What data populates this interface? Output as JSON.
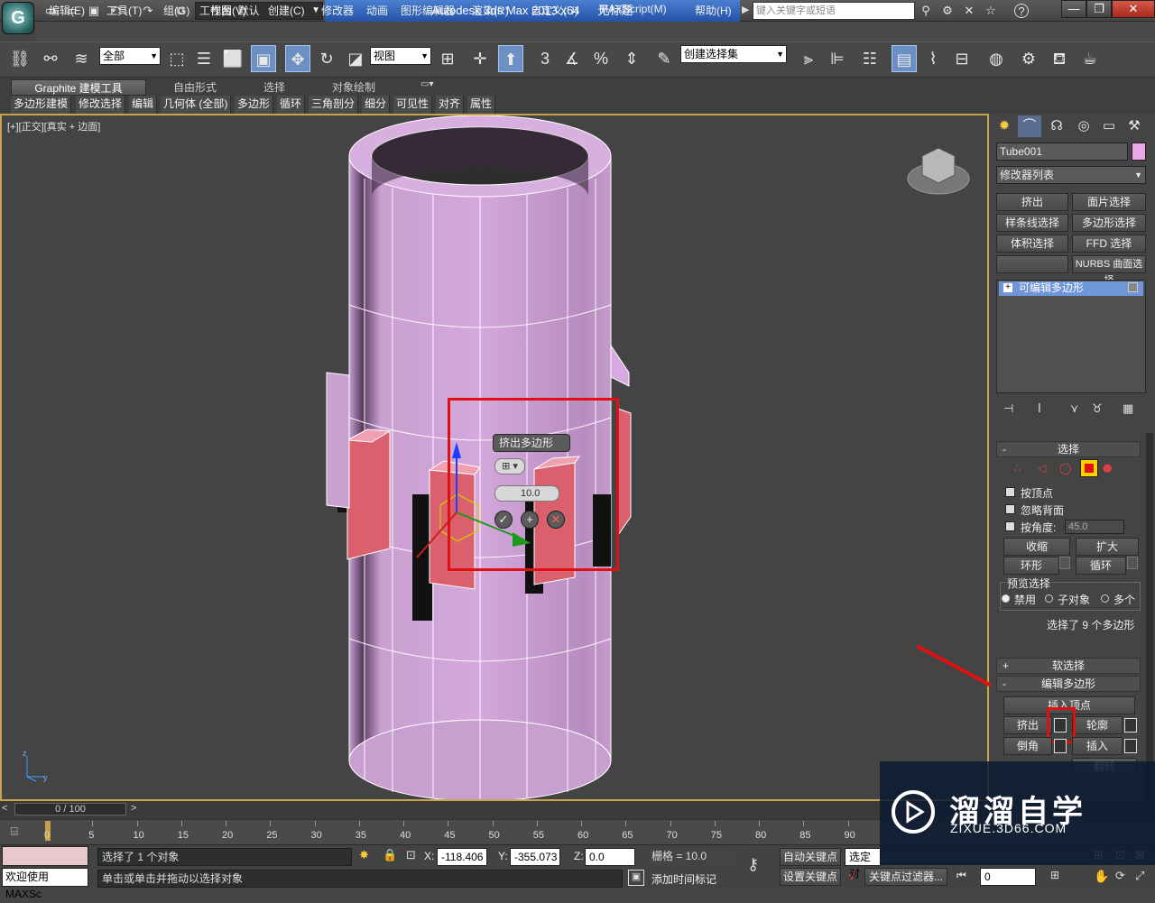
{
  "titlebar": {
    "app_title": "Autodesk 3ds Max  2013 x64",
    "doc_title": "无标题",
    "workspace_label": "工作台: 默认",
    "search_placeholder": "键入关键字或短语",
    "help_icon": "?"
  },
  "menu": [
    "编辑(E)",
    "工具(T)",
    "组(G)",
    "视图(V)",
    "创建(C)",
    "修改器",
    "动画",
    "图形编辑器",
    "渲染(R)",
    "自定义(U)",
    "MAXScript(M)",
    "帮助(H)"
  ],
  "toolbar": {
    "filter_value": "全部",
    "refcoord_value": "视图",
    "selset_value": "创建选择集",
    "snap_label": "3",
    "percent_label": "%"
  },
  "ribbon": {
    "tabs": [
      "Graphite 建模工具",
      "自由形式",
      "选择",
      "对象绘制"
    ],
    "subtabs": [
      "多边形建模",
      "修改选择",
      "编辑",
      "几何体 (全部)",
      "多边形",
      "循环",
      "三角剖分",
      "细分",
      "可见性",
      "对齐",
      "属性"
    ]
  },
  "viewport": {
    "label": "[+][正交][真实 + 边面]"
  },
  "caddy": {
    "title": "挤出多边形",
    "height_value": "10.0",
    "ok_icon": "✓",
    "apply_icon": "+",
    "cancel_icon": "✕"
  },
  "panel": {
    "object_name": "Tube001",
    "object_color": "#e8a8e8",
    "modifier_list": "修改器列表",
    "mod_buttons": [
      "挤出",
      "面片选择",
      "样条线选择",
      "多边形选择",
      "体积选择",
      "FFD 选择",
      "",
      "NURBS 曲面选择"
    ],
    "stack_item": "可编辑多边形",
    "selection_rollout": "选择",
    "by_vertex": "按顶点",
    "ignore_back": "忽略背面",
    "by_angle": "按角度:",
    "angle_value": "45.0",
    "shrink": "收缩",
    "grow": "扩大",
    "ring": "环形",
    "loop": "循环",
    "preview_label": "预览选择",
    "preview_opts": [
      "禁用",
      "子对象",
      "多个"
    ],
    "sel_info": "选择了 9 个多边形",
    "soft_rollout": "软选择",
    "edit_poly_rollout": "编辑多边形",
    "insert_vertex": "插入顶点",
    "extrude": "挤出",
    "outline": "轮廓",
    "bevel": "倒角",
    "inset": "插入",
    "flip": "翻转"
  },
  "timeline": {
    "frame": "0 / 100",
    "ticks": [
      "0",
      "5",
      "10",
      "15",
      "20",
      "25",
      "30",
      "35",
      "40",
      "45",
      "50",
      "55",
      "60",
      "65",
      "70",
      "75",
      "80",
      "85",
      "90"
    ]
  },
  "status": {
    "script_label": "欢迎使用 MAXSc",
    "selected": "选择了 1 个对象",
    "prompt": "单击或单击并拖动以选择对象",
    "x_label": "X:",
    "x_value": "-118.406",
    "y_label": "Y:",
    "y_value": "-355.073",
    "z_label": "Z:",
    "z_value": "0.0",
    "grid": "栅格 = 10.0",
    "add_time_tag": "添加时间标记",
    "auto_key": "自动关键点",
    "set_key": "设置关键点",
    "selected_obj": "选定对",
    "key_filter": "关键点过滤器...",
    "frame_value": "0"
  },
  "watermark": {
    "title": "溜溜自学",
    "url": "ZIXUE.3D66.COM"
  }
}
